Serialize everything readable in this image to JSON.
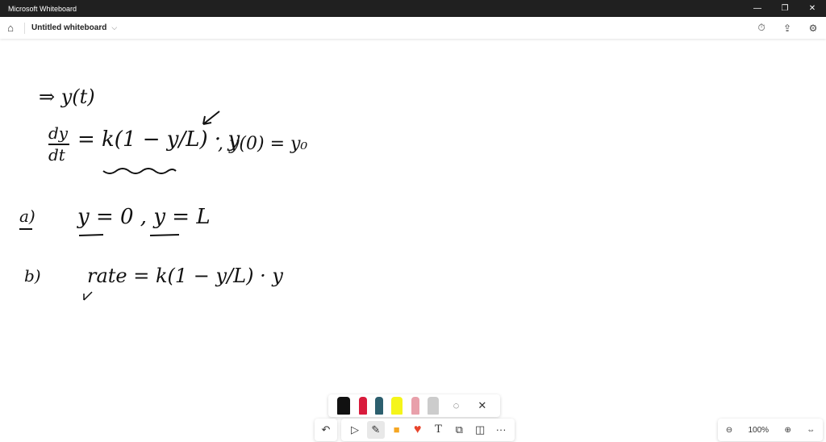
{
  "window": {
    "title": "Microsoft Whiteboard",
    "minimize": "—",
    "restore": "❐",
    "close": "✕"
  },
  "appbar": {
    "home_icon": "⌂",
    "title": "Untitled whiteboard",
    "chevron": "⌵",
    "timer_icon": "⏱",
    "share_icon": "⇪",
    "settings_icon": "⚙"
  },
  "canvas": {
    "line1": "⇒  y(t)",
    "eq_lhs_num": "dy",
    "eq_lhs_den": "dt",
    "eq_rhs": "= k(1 − y/L) · y",
    "initial": ", y(0) = y₀",
    "part_a_label": "a)",
    "part_a_text": "y = 0  ,  y = L",
    "part_b_label": "b)",
    "part_b_text": "rate  =  k(1 − y/L) · y"
  },
  "pens": {
    "colors": [
      "#111111",
      "#d81b3c",
      "#2c5f6e",
      "#f5f51a",
      "#e8a0aa",
      "#cccccc"
    ],
    "lasso_icon": "◌",
    "close_icon": "✕"
  },
  "toolbar": {
    "undo_icon": "↶",
    "select_icon": "▷",
    "pen_icon": "✎",
    "note_icon": "■",
    "reaction_icon": "♥",
    "text_icon": "T",
    "shapes_icon": "⧉",
    "template_icon": "◫",
    "more_icon": "···"
  },
  "zoom": {
    "zoom_out_icon": "⊖",
    "level": "100%",
    "zoom_in_icon": "⊕",
    "fit_icon": "⇔"
  }
}
